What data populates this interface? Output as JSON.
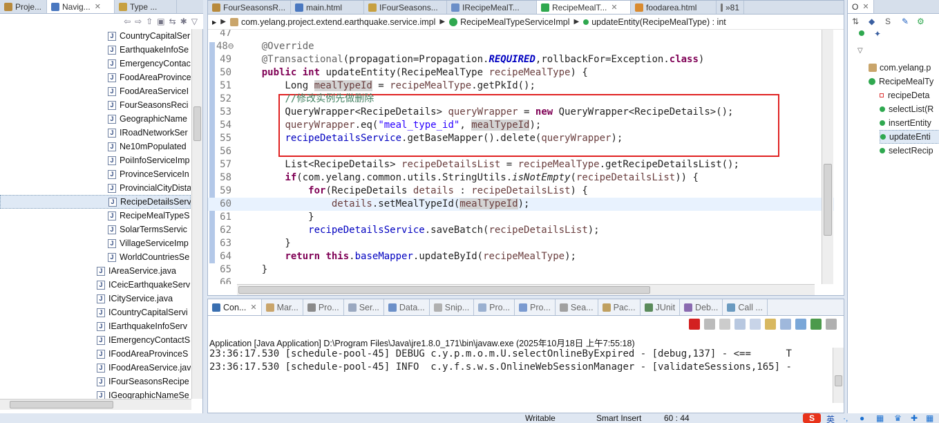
{
  "left_panel": {
    "tabs": [
      {
        "label": "Proje..."
      },
      {
        "label": "Navig...",
        "active": true
      },
      {
        "label": "Type ..."
      }
    ],
    "tree_items": [
      {
        "label": "CountryCapitalSer",
        "indent": 1
      },
      {
        "label": "EarthquakeInfoSe",
        "indent": 1
      },
      {
        "label": "EmergencyContac",
        "indent": 1
      },
      {
        "label": "FoodAreaProvince",
        "indent": 1
      },
      {
        "label": "FoodAreaServiceI",
        "indent": 1
      },
      {
        "label": "FourSeasonsReci",
        "indent": 1
      },
      {
        "label": "GeographicName",
        "indent": 1
      },
      {
        "label": "IRoadNetworkSer",
        "indent": 1
      },
      {
        "label": "Ne10mPopulated",
        "indent": 1
      },
      {
        "label": "PoiInfoServiceImp",
        "indent": 1
      },
      {
        "label": "ProvinceServiceIn",
        "indent": 1
      },
      {
        "label": "ProvincialCityDista",
        "indent": 1
      },
      {
        "label": "RecipeDetailsServ",
        "indent": 1,
        "selected": true
      },
      {
        "label": "RecipeMealTypeS",
        "indent": 1
      },
      {
        "label": "SolarTermsServic",
        "indent": 1
      },
      {
        "label": "VillageServiceImp",
        "indent": 1
      },
      {
        "label": "WorldCountriesSe",
        "indent": 1
      },
      {
        "label": "IAreaService.java",
        "indent": 0
      },
      {
        "label": "ICeicEarthquakeServ",
        "indent": 0
      },
      {
        "label": "ICityService.java",
        "indent": 0
      },
      {
        "label": "ICountryCapitalServi",
        "indent": 0
      },
      {
        "label": "IEarthquakeInfoServ",
        "indent": 0
      },
      {
        "label": "IEmergencyContactS",
        "indent": 0
      },
      {
        "label": "IFoodAreaProvinceS",
        "indent": 0
      },
      {
        "label": "IFoodAreaService.jav",
        "indent": 0
      },
      {
        "label": "IFourSeasonsRecipe",
        "indent": 0
      },
      {
        "label": "IGeographicNameSe",
        "indent": 0
      }
    ]
  },
  "editor": {
    "tabs": [
      {
        "label": "FourSeasonsR..."
      },
      {
        "label": "main.html"
      },
      {
        "label": "IFourSeasons..."
      },
      {
        "label": "IRecipeMealT..."
      },
      {
        "label": "RecipeMealT...",
        "active": true
      },
      {
        "label": "foodarea.html"
      },
      {
        "label": "»81"
      }
    ],
    "breadcrumb": {
      "package": "com.yelang.project.extend.earthquake.service.impl",
      "class": "RecipeMealTypeServiceImpl",
      "method": "updateEntity(RecipeMealType) : int"
    },
    "lines": [
      {
        "n": "47",
        "html": ""
      },
      {
        "n": "48⊖",
        "html": "    <span class='ann'>@Override</span>"
      },
      {
        "n": "49",
        "html": "    <span class='ann'>@Transactional</span>(propagation=Propagation.<span class='fld ital' style='font-weight:bold'>REQUIRED</span>,rollbackFor=Exception.<span class='kw'>class</span>)"
      },
      {
        "n": "50",
        "html": "    <span class='kw'>public</span> <span class='kw'>int</span> updateEntity(RecipeMealType <span class='var'>recipeMealType</span>) {"
      },
      {
        "n": "51",
        "html": "        Long <span class='var hl'>mealTypeId</span> = <span class='var'>recipeMealType</span>.getPkId();"
      },
      {
        "n": "52",
        "html": "        <span class='cmt'>//修改实例先做删除</span>"
      },
      {
        "n": "53",
        "html": "        QueryWrapper&lt;RecipeDetails&gt; <span class='var'>queryWrapper</span> = <span class='kw'>new</span> QueryWrapper&lt;RecipeDetails&gt;();"
      },
      {
        "n": "54",
        "html": "        <span class='var'>queryWrapper</span>.eq(<span class='str'>\"meal_type_id\"</span>, <span class='var hl'>mealTypeId</span>);"
      },
      {
        "n": "55",
        "html": "        <span class='fld'>recipeDetailsService</span>.getBaseMapper().delete(<span class='var'>queryWrapper</span>);"
      },
      {
        "n": "56",
        "html": ""
      },
      {
        "n": "57",
        "html": "        List&lt;RecipeDetails&gt; <span class='var'>recipeDetailsList</span> = <span class='var'>recipeMealType</span>.getRecipeDetailsList();"
      },
      {
        "n": "58",
        "html": "        <span class='kw'>if</span>(com.yelang.common.utils.StringUtils.<span class='ital'>isNotEmpty</span>(<span class='var'>recipeDetailsList</span>)) {"
      },
      {
        "n": "59",
        "html": "            <span class='kw'>for</span>(RecipeDetails <span class='var'>details</span> : <span class='var'>recipeDetailsList</span>) {"
      },
      {
        "n": "60",
        "html": "                <span class='var'>details</span>.setMealTypeId(<span class='var hl'>mealTypeId</span>);",
        "current": true
      },
      {
        "n": "61",
        "html": "            }"
      },
      {
        "n": "62",
        "html": "            <span class='fld'>recipeDetailsService</span>.saveBatch(<span class='var'>recipeDetailsList</span>);"
      },
      {
        "n": "63",
        "html": "        }"
      },
      {
        "n": "64",
        "html": "        <span class='kw'>return</span> <span class='kw'>this</span>.<span class='fld'>baseMapper</span>.updateById(<span class='var'>recipeMealType</span>);"
      },
      {
        "n": "65",
        "html": "    }"
      },
      {
        "n": "66",
        "html": ""
      }
    ]
  },
  "console": {
    "tabs": [
      {
        "label": "Con...",
        "active": true
      },
      {
        "label": "Mar..."
      },
      {
        "label": "Pro..."
      },
      {
        "label": "Ser..."
      },
      {
        "label": "Data..."
      },
      {
        "label": "Snip..."
      },
      {
        "label": "Pro..."
      },
      {
        "label": "Pro..."
      },
      {
        "label": "Sea..."
      },
      {
        "label": "Pac..."
      },
      {
        "label": "JUnit"
      },
      {
        "label": "Deb..."
      },
      {
        "label": "Call ..."
      }
    ],
    "title": "Application [Java Application] D:\\Program Files\\Java\\jre1.8.0_171\\bin\\javaw.exe (2025年10月18日 上午7:55:18)",
    "output": [
      "23:36:17.530 [schedule-pool-45] DEBUG c.y.p.m.o.m.U.selectOnlineByExpired - [debug,137] - <==      T",
      "23:36:17.530 [schedule-pool-45] INFO  c.y.f.s.w.s.OnlineWebSessionManager - [validateSessions,165] -"
    ]
  },
  "outline": {
    "tab": "O",
    "items": [
      {
        "label": "com.yelang.p",
        "kind": "import"
      },
      {
        "label": "RecipeMealTy",
        "kind": "class"
      },
      {
        "label": "recipeDeta",
        "kind": "field"
      },
      {
        "label": "selectList(R",
        "kind": "method"
      },
      {
        "label": "insertEntity",
        "kind": "method"
      },
      {
        "label": "updateEnti",
        "kind": "method",
        "selected": true
      },
      {
        "label": "selectRecip",
        "kind": "method"
      }
    ]
  },
  "status": {
    "mode": "Writable",
    "insert": "Smart Insert",
    "position": "60 : 44",
    "ime": "英"
  }
}
